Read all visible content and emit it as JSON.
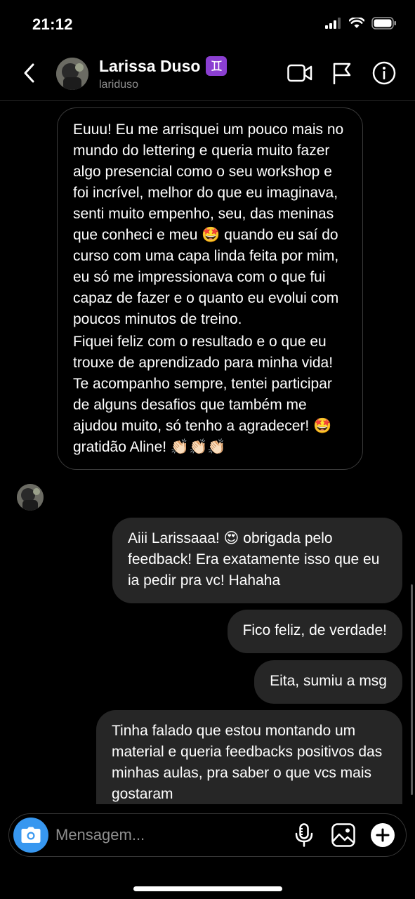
{
  "status_bar": {
    "time": "21:12"
  },
  "header": {
    "name": "Larissa Duso",
    "zodiac_symbol": "♊",
    "handle": "lariduso",
    "icons": {
      "back": "chevron-left-icon",
      "video": "video-camera-icon",
      "flag": "flag-icon",
      "info": "info-icon"
    }
  },
  "messages": [
    {
      "direction": "incoming",
      "paragraphs": [
        "Euuu! Eu me arrisquei um pouco mais no mundo do lettering e queria muito fazer algo presencial como o seu workshop e foi incrível, melhor do que eu imaginava, senti muito empenho, seu, das meninas que conheci e meu 🤩 quando eu saí do curso com uma capa linda feita por mim, eu só me impressionava com o que fui capaz de fazer e o quanto eu evolui com poucos minutos de treino.",
        "Fiquei feliz com o resultado e o que eu trouxe de aprendizado para minha vida!  Te acompanho sempre, tentei participar de alguns desafios que também me ajudou muito, só tenho a agradecer! 🤩 gratidão Aline! 👏🏻👏🏻👏🏻"
      ]
    },
    {
      "direction": "outgoing",
      "text": "Aiii Larissaaa! 😍 obrigada pelo feedback! Era exatamente isso que eu ia pedir pra vc! Hahaha"
    },
    {
      "direction": "outgoing",
      "text": "Fico feliz, de verdade!"
    },
    {
      "direction": "outgoing",
      "text": "Eita, sumiu a msg"
    },
    {
      "direction": "outgoing",
      "text": "Tinha falado que estou montando um material e queria feedbacks positivos das minhas aulas, pra saber o que vcs mais gostaram"
    }
  ],
  "composer": {
    "placeholder": "Mensagem...",
    "icons": {
      "camera": "camera-icon",
      "mic": "microphone-icon",
      "gallery": "gallery-icon",
      "plus": "plus-icon"
    }
  },
  "colors": {
    "accent": "#3797f0",
    "bubble_out": "#262626",
    "zodiac_bg": "#8b3fd1"
  }
}
